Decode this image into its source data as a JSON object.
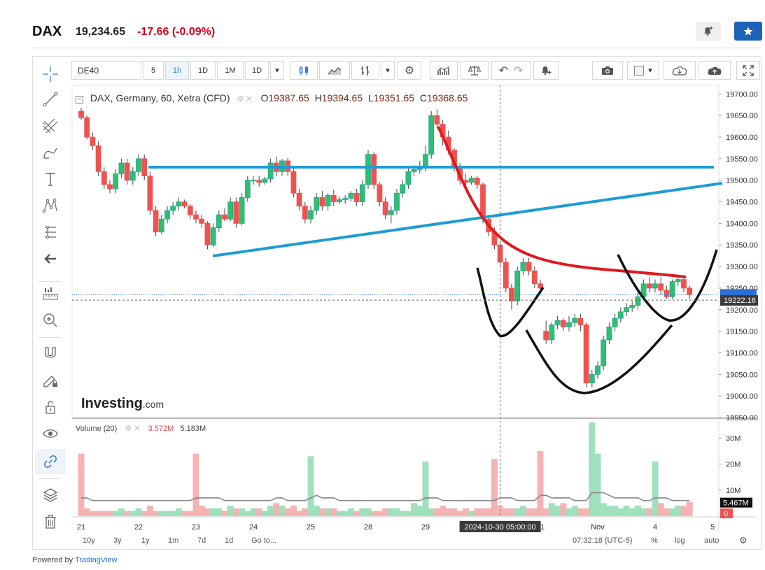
{
  "header": {
    "symbol": "DAX",
    "price": "19,234.65",
    "change": "-17.66",
    "change_pct": "(-0.09%)"
  },
  "toolbar": {
    "symbol_input": "DE40",
    "intervals": [
      "5",
      "1h",
      "1D",
      "1M",
      "1D"
    ],
    "active_interval": "1h"
  },
  "legend": {
    "title": "DAX, Germany, 60, Xetra (CFD)",
    "open_label": "O",
    "open": "19387.65",
    "high_label": "H",
    "high": "19394.65",
    "low_label": "L",
    "low": "19351.65",
    "close_label": "C",
    "close": "19368.65"
  },
  "volume_legend": {
    "title": "Volume (20)",
    "value1": "3.572M",
    "value2": "5.183M"
  },
  "watermark": "Investing",
  "watermark_suffix": ".com",
  "bottom_bar": {
    "ranges": [
      "10y",
      "3y",
      "1y",
      "1m",
      "7d",
      "1d"
    ],
    "goto": "Go to...",
    "time": "07:32:18 (UTC-5)",
    "pct": "%",
    "log": "log",
    "auto": "auto"
  },
  "powered_by": "Powered by",
  "powered_by_brand": "TradingView",
  "colors": {
    "up": "#26a69a",
    "up_fill": "#2fbf71",
    "down": "#ef5350",
    "vol_up": "#9fe0bd",
    "vol_down": "#f6b3b3",
    "trendline": "#1e9bd7",
    "red_curve": "#e0191f",
    "black_curve": "#111111",
    "price_label_bg": "#3a3a3a"
  },
  "chart_data": {
    "type": "candlestick",
    "interval": "60",
    "y_axis": {
      "min": 18950,
      "max": 19720,
      "ticks": [
        "19700.00",
        "19650.00",
        "19600.00",
        "19550.00",
        "19500.00",
        "19450.00",
        "19400.00",
        "19350.00",
        "19300.00",
        "19250.00",
        "19200.00",
        "19150.00",
        "19100.00",
        "19050.00",
        "19000.00",
        "18950.00"
      ],
      "last_price_label": "19234.65",
      "crosshair_label": "19222.16",
      "crosshair_price": 19222.16
    },
    "x_axis": {
      "ticks": [
        {
          "label": "21",
          "bar": 0
        },
        {
          "label": "22",
          "bar": 10
        },
        {
          "label": "23",
          "bar": 20
        },
        {
          "label": "24",
          "bar": 30
        },
        {
          "label": "25",
          "bar": 40
        },
        {
          "label": "28",
          "bar": 50
        },
        {
          "label": "29",
          "bar": 60
        },
        {
          "label": "31",
          "bar": 80
        },
        {
          "label": "Nov",
          "bar": 90
        },
        {
          "label": "4",
          "bar": 100
        },
        {
          "label": "5",
          "bar": 110
        }
      ],
      "crosshair_label": "2024-10-30 05:00:00",
      "crosshair_bar": 73
    },
    "ohlc": [
      [
        19660,
        19668,
        19640,
        19645
      ],
      [
        19645,
        19650,
        19595,
        19600
      ],
      [
        19600,
        19610,
        19570,
        19580
      ],
      [
        19580,
        19590,
        19510,
        19520
      ],
      [
        19520,
        19530,
        19480,
        19490
      ],
      [
        19490,
        19500,
        19470,
        19480
      ],
      [
        19480,
        19525,
        19470,
        19515
      ],
      [
        19515,
        19550,
        19505,
        19540
      ],
      [
        19540,
        19550,
        19490,
        19500
      ],
      [
        19500,
        19530,
        19490,
        19520
      ],
      [
        19520,
        19560,
        19510,
        19550
      ],
      [
        19550,
        19560,
        19500,
        19510
      ],
      [
        19510,
        19520,
        19420,
        19430
      ],
      [
        19430,
        19440,
        19370,
        19380
      ],
      [
        19380,
        19420,
        19375,
        19410
      ],
      [
        19410,
        19440,
        19400,
        19430
      ],
      [
        19430,
        19450,
        19420,
        19440
      ],
      [
        19440,
        19460,
        19430,
        19450
      ],
      [
        19450,
        19455,
        19435,
        19440
      ],
      [
        19440,
        19445,
        19410,
        19420
      ],
      [
        19420,
        19430,
        19400,
        19410
      ],
      [
        19410,
        19420,
        19390,
        19400
      ],
      [
        19400,
        19405,
        19340,
        19350
      ],
      [
        19350,
        19400,
        19345,
        19390
      ],
      [
        19390,
        19430,
        19380,
        19420
      ],
      [
        19420,
        19435,
        19405,
        19410
      ],
      [
        19410,
        19460,
        19405,
        19450
      ],
      [
        19450,
        19460,
        19390,
        19400
      ],
      [
        19400,
        19470,
        19395,
        19460
      ],
      [
        19460,
        19510,
        19450,
        19500
      ],
      [
        19500,
        19510,
        19490,
        19500
      ],
      [
        19500,
        19510,
        19485,
        19495
      ],
      [
        19495,
        19508,
        19490,
        19503
      ],
      [
        19503,
        19550,
        19495,
        19540
      ],
      [
        19540,
        19555,
        19510,
        19520
      ],
      [
        19520,
        19550,
        19510,
        19545
      ],
      [
        19545,
        19552,
        19510,
        19520
      ],
      [
        19520,
        19530,
        19460,
        19470
      ],
      [
        19470,
        19480,
        19430,
        19440
      ],
      [
        19440,
        19450,
        19400,
        19410
      ],
      [
        19410,
        19440,
        19400,
        19430
      ],
      [
        19430,
        19470,
        19420,
        19460
      ],
      [
        19460,
        19475,
        19430,
        19440
      ],
      [
        19440,
        19470,
        19430,
        19465
      ],
      [
        19465,
        19478,
        19440,
        19450
      ],
      [
        19450,
        19462,
        19445,
        19455
      ],
      [
        19455,
        19465,
        19445,
        19458
      ],
      [
        19458,
        19475,
        19450,
        19470
      ],
      [
        19470,
        19480,
        19440,
        19450
      ],
      [
        19450,
        19500,
        19440,
        19490
      ],
      [
        19490,
        19570,
        19480,
        19560
      ],
      [
        19560,
        19565,
        19480,
        19490
      ],
      [
        19490,
        19495,
        19440,
        19450
      ],
      [
        19450,
        19460,
        19410,
        19420
      ],
      [
        19420,
        19440,
        19400,
        19430
      ],
      [
        19430,
        19480,
        19420,
        19470
      ],
      [
        19470,
        19500,
        19460,
        19490
      ],
      [
        19490,
        19530,
        19480,
        19520
      ],
      [
        19520,
        19535,
        19510,
        19525
      ],
      [
        19525,
        19545,
        19515,
        19530
      ],
      [
        19530,
        19580,
        19520,
        19560
      ],
      [
        19560,
        19660,
        19550,
        19650
      ],
      [
        19650,
        19665,
        19620,
        19630
      ],
      [
        19630,
        19640,
        19580,
        19600
      ],
      [
        19600,
        19615,
        19560,
        19570
      ],
      [
        19570,
        19575,
        19520,
        19530
      ],
      [
        19530,
        19540,
        19490,
        19500
      ],
      [
        19500,
        19515,
        19485,
        19495
      ],
      [
        19495,
        19510,
        19490,
        19505
      ],
      [
        19505,
        19510,
        19480,
        19490
      ],
      [
        19490,
        19495,
        19400,
        19410
      ],
      [
        19410,
        19420,
        19370,
        19380
      ],
      [
        19380,
        19390,
        19340,
        19350
      ],
      [
        19350,
        19360,
        19300,
        19310
      ],
      [
        19310,
        19320,
        19240,
        19250
      ],
      [
        19250,
        19260,
        19200,
        19220
      ],
      [
        19220,
        19300,
        19210,
        19290
      ],
      [
        19290,
        19320,
        19280,
        19310
      ],
      [
        19310,
        19320,
        19280,
        19290
      ],
      [
        19290,
        19300,
        19250,
        19260
      ],
      [
        19260,
        19270,
        19240,
        19250
      ],
      [
        19150,
        19175,
        19120,
        19130
      ],
      [
        19130,
        19170,
        19120,
        19165
      ],
      [
        19165,
        19185,
        19155,
        19175
      ],
      [
        19175,
        19180,
        19150,
        19160
      ],
      [
        19160,
        19185,
        19150,
        19170
      ],
      [
        19170,
        19190,
        19160,
        19180
      ],
      [
        19180,
        19190,
        19150,
        19165
      ],
      [
        19165,
        19170,
        19020,
        19030
      ],
      [
        19030,
        19060,
        19020,
        19050
      ],
      [
        19050,
        19080,
        19040,
        19070
      ],
      [
        19070,
        19140,
        19060,
        19130
      ],
      [
        19130,
        19170,
        19120,
        19160
      ],
      [
        19160,
        19190,
        19150,
        19180
      ],
      [
        19180,
        19205,
        19170,
        19195
      ],
      [
        19195,
        19215,
        19185,
        19205
      ],
      [
        19205,
        19220,
        19195,
        19210
      ],
      [
        19210,
        19240,
        19200,
        19230
      ],
      [
        19230,
        19270,
        19220,
        19260
      ],
      [
        19260,
        19275,
        19240,
        19250
      ],
      [
        19250,
        19270,
        19240,
        19260
      ],
      [
        19260,
        19275,
        19235,
        19245
      ],
      [
        19245,
        19255,
        19225,
        19230
      ],
      [
        19230,
        19270,
        19225,
        19265
      ],
      [
        19265,
        19280,
        19255,
        19270
      ],
      [
        19270,
        19275,
        19240,
        19250
      ],
      [
        19250,
        19255,
        19225,
        19235
      ]
    ],
    "volume": {
      "axis_ticks": [
        "30M",
        "20M",
        "10M"
      ],
      "axis_max": 36,
      "last_label": "5.467M",
      "zero_label": "0",
      "values": [
        24,
        3,
        2,
        2,
        2,
        2,
        2,
        3,
        2,
        2,
        3,
        2,
        4,
        2,
        2,
        2,
        2,
        3,
        2,
        2,
        24,
        4,
        3,
        3,
        3,
        2,
        4,
        3,
        3,
        2,
        3,
        3,
        2,
        4,
        5,
        4,
        3,
        4,
        2,
        3,
        23,
        4,
        3,
        3,
        3,
        2,
        2,
        3,
        2,
        3,
        3,
        2,
        2,
        3,
        3,
        3,
        2,
        2,
        5,
        4,
        21,
        3,
        3,
        4,
        3,
        3,
        2,
        3,
        2,
        3,
        3,
        3,
        22,
        4,
        3,
        3,
        3,
        4,
        3,
        3,
        25,
        3,
        5,
        4,
        5,
        3,
        4,
        3,
        3,
        36,
        24,
        5,
        4,
        4,
        3,
        4,
        3,
        4,
        3,
        3,
        21,
        5,
        3,
        3,
        4,
        4,
        5.467
      ],
      "ma20": [
        7,
        7,
        6,
        6,
        6,
        6,
        6,
        6,
        6,
        6,
        6,
        6,
        6,
        6,
        6,
        6,
        6,
        6,
        6,
        6,
        7,
        7,
        7,
        7,
        7,
        6,
        6,
        6,
        6,
        6,
        6,
        6,
        6,
        6,
        7,
        7,
        6,
        6,
        6,
        6,
        7,
        8,
        7,
        7,
        7,
        6,
        6,
        6,
        6,
        6,
        6,
        6,
        6,
        6,
        6,
        6,
        6,
        6,
        6,
        6,
        7,
        7,
        7,
        6,
        6,
        6,
        6,
        6,
        6,
        6,
        6,
        6,
        6,
        7,
        7,
        7,
        6,
        6,
        6,
        6,
        8,
        8,
        7,
        7,
        7,
        7,
        6,
        6,
        6,
        9,
        9,
        9,
        8,
        7,
        7,
        7,
        7,
        7,
        6,
        6,
        7,
        7,
        7,
        6,
        6,
        6,
        6
      ]
    }
  }
}
